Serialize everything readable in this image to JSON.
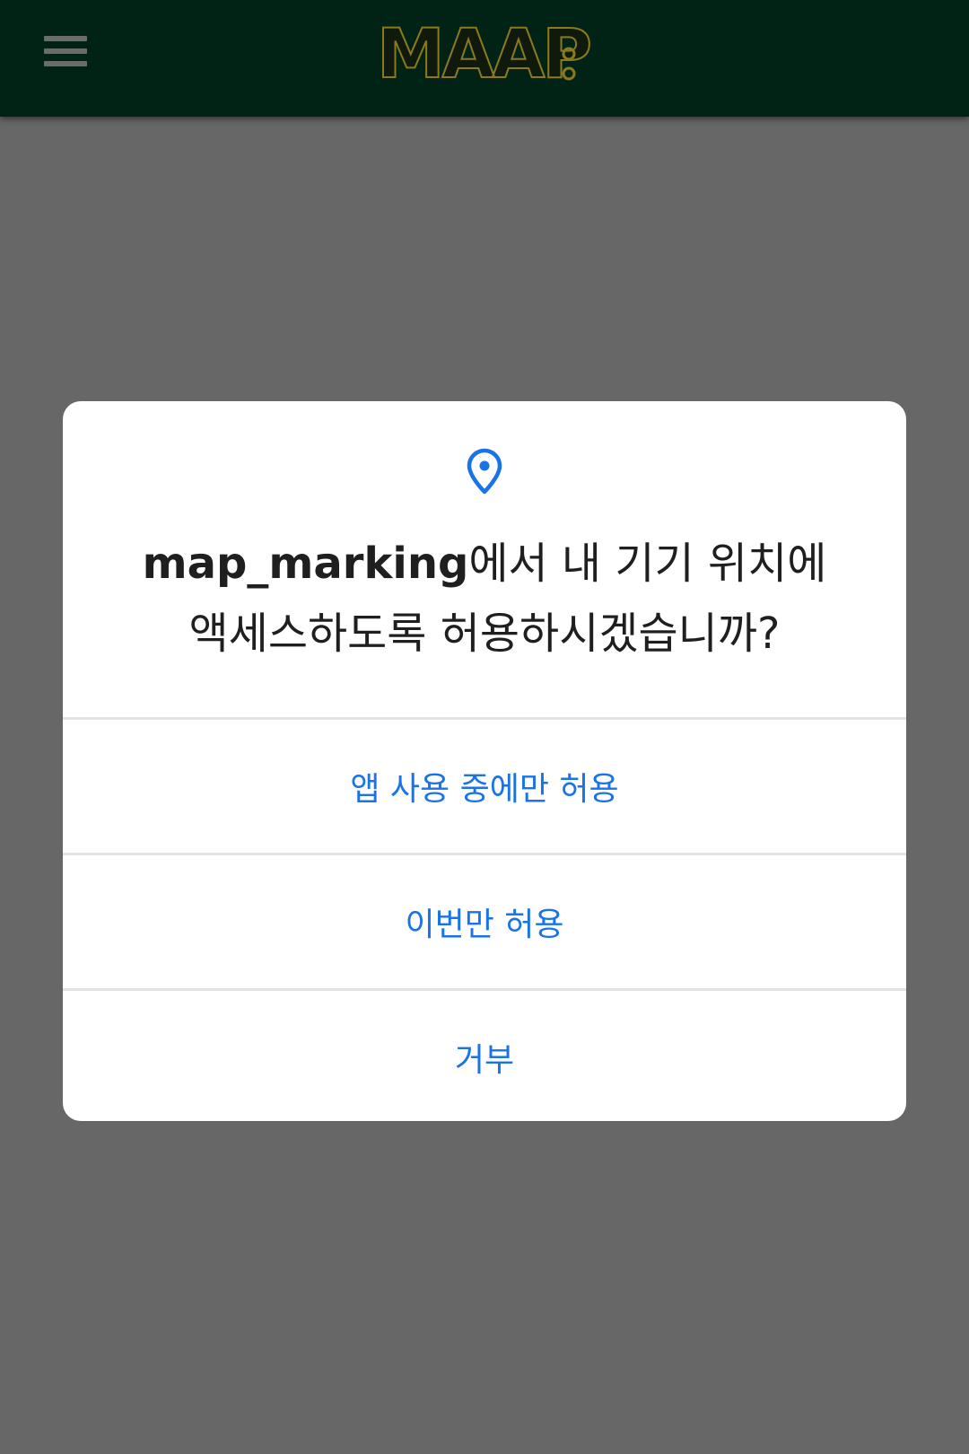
{
  "app_bar": {
    "menu_icon": "hamburger-menu-icon",
    "logo_text": "MAAP",
    "background": "#012316"
  },
  "dialog": {
    "icon": "location-pin-icon",
    "icon_color": "#1a73e8",
    "app_name": "map_marking",
    "message_line1_rest": "에서 내 기기 위치에",
    "message_line2": "액세스하도록 허용하시겠습니까?",
    "options": [
      {
        "label": "앱 사용 중에만 허용"
      },
      {
        "label": "이번만 허용"
      },
      {
        "label": "거부"
      }
    ]
  },
  "colors": {
    "scrim": "#676767",
    "option_text": "#1a73e8",
    "message_text": "#1f1f1f"
  }
}
